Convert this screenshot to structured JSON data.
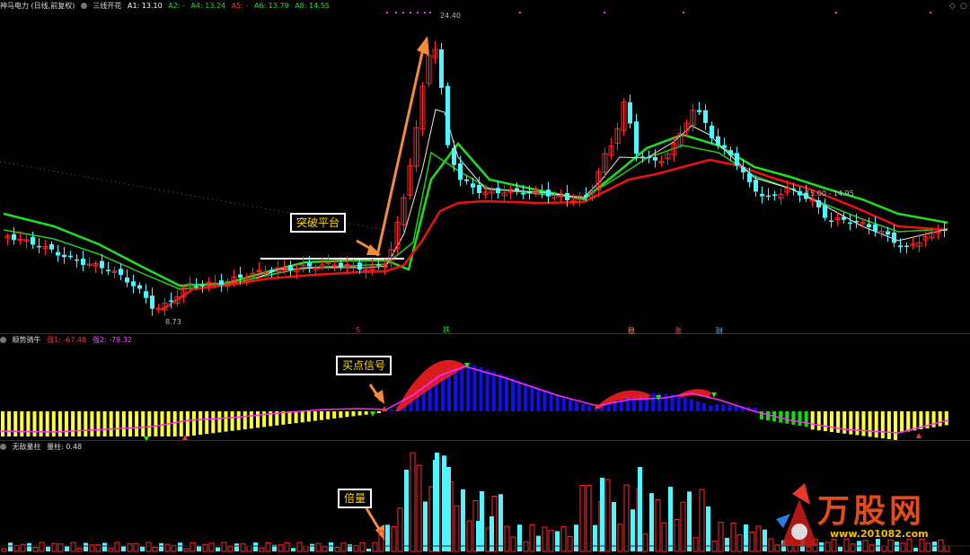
{
  "main_header": {
    "stock": "神马电力 (日线,前复权)",
    "indicator": "三线开花",
    "a1": "A1: 13.10",
    "a2": "A2: -",
    "a4": "A4: 13.24",
    "a5": "A5: -",
    "a6": "A6: 13.79",
    "a8": "A8: 14.55"
  },
  "mid_header": {
    "indicator": "顺势骑牛",
    "strong1": "强1: -67.48",
    "strong2": "强2: -79.32"
  },
  "low_header": {
    "indicator": "无敌量柱",
    "value": "量柱: 0.48"
  },
  "annotations": {
    "breakout": "突破平台",
    "buy_signal": "买点信号",
    "double_volume": "倍量"
  },
  "price_labels": {
    "high": "24.40",
    "low": "8.73",
    "range": "15.00 - 14.95"
  },
  "event_marks": [
    "S",
    "跌",
    "稳",
    "涨",
    "财"
  ],
  "window_controls": {
    "restore": "◇",
    "close": "○"
  },
  "watermark": {
    "title": "万股网",
    "url": "www.201082.com"
  },
  "colors": {
    "up": "#ff2a2a",
    "down": "#4ff6ff",
    "slow_ma": "#ee1111",
    "fast_ma": "#22dd22",
    "bull": "#ffff33",
    "bear_bar": "#1010ee",
    "green_bar": "#11dd11"
  }
}
